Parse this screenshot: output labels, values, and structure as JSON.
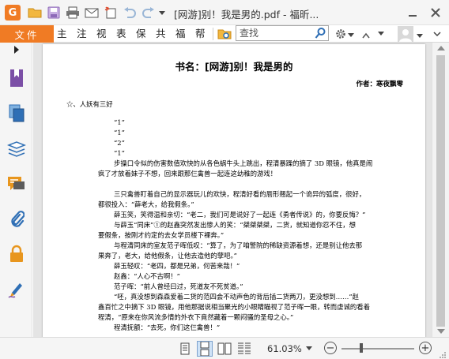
{
  "window": {
    "title": "[网游]别！我是男的.pdf - 福昕...",
    "minimize_icon": "minimize-icon",
    "close_icon": "close-icon"
  },
  "quick_access": [
    "open-folder-icon",
    "save-icon",
    "print-icon",
    "email-icon",
    "new-icon",
    "undo-icon",
    "redo-icon",
    "customize-dropdown-icon"
  ],
  "menu": {
    "file": "文件",
    "items": [
      "主页",
      "注释",
      "视图",
      "表单",
      "保护",
      "共享",
      "福昕",
      "帮助"
    ],
    "search_placeholder": "查找",
    "user_avatar": "avatar-icon"
  },
  "sidebar": {
    "items": [
      "bookmark-icon",
      "pages-icon",
      "layers-icon",
      "comments-icon",
      "attachments-icon",
      "security-icon",
      "signature-icon"
    ]
  },
  "document": {
    "title": "书名：[网游]别！我是男的",
    "author": "作者：寒夜飘零",
    "paragraphs": [
      "☆、人妖有三好",
      "“1”",
      "“1”",
      "“2”",
      "“1”",
      "步操口令似的伤害数值欢快的从各色蜗牛头上跳出，程清暴躁的摘了 3D 眼镜，他真是闹",
      "疯了才放着妹子不想，回来跟那仨禽兽一起连这幼稚的游戏！",
      "",
      "三只禽兽盯着自己的显示器玩儿的欢快，程清好看的唇形翘起一个诡异的弧度，很好，",
      "都很投入：“薛老大，给我假条。”",
      "薛玉笑，笑得温和亲切：“老二，我们可是说好了一起连《勇者传说》的，你要反悔？”",
      "与薛玉“同床”①的赵鑫突然发出惨人的笑：“桀桀桀桀，二货，就知道你忍不住，想",
      "要假条，按刚才约定的去女学员楼下裸奔。”",
      "与程清同床的室友范子晖低叹：“算了，为了咱警院的稀缺资源着想，还是别让他去那",
      "果奔了，老大，给他假条，让他去造他的孽吧。”",
      "薛玉轻叹：“老四，都是兄弟，何苦来哉！”",
      "赵鑫：“人心不古啊！”",
      "范子晖：“前人曾经曰过，死道友不死贫道。”",
      "“呸，真没想到森森爱着二货的范四会不动声色的背后插二货两刀，更没想到……”赵",
      "鑫百忙之中摘下 3D 眼镜，用他那据说相当聚光的小眼睛瞄视了范子晖一眼，转而虔诚的看着",
      "程清，“原来在你风流多情的外衣下竟然藏着一颗闷骚的圣母之心。”",
      "程清抚额：“去死，你们这仨禽兽！”"
    ]
  },
  "statusbar": {
    "view_modes": [
      "single-page-icon",
      "continuous-page-icon",
      "facing-pages-icon",
      "continuous-facing-icon"
    ],
    "zoom_level": "61.03%",
    "zoom_minus": "−",
    "zoom_plus": "+"
  },
  "colors": {
    "accent": "#f07b24",
    "sidebar_icon_blue": "#2f6fb5",
    "sidebar_icon_purple": "#7b4fa6",
    "sidebar_icon_orange": "#e8961e"
  }
}
